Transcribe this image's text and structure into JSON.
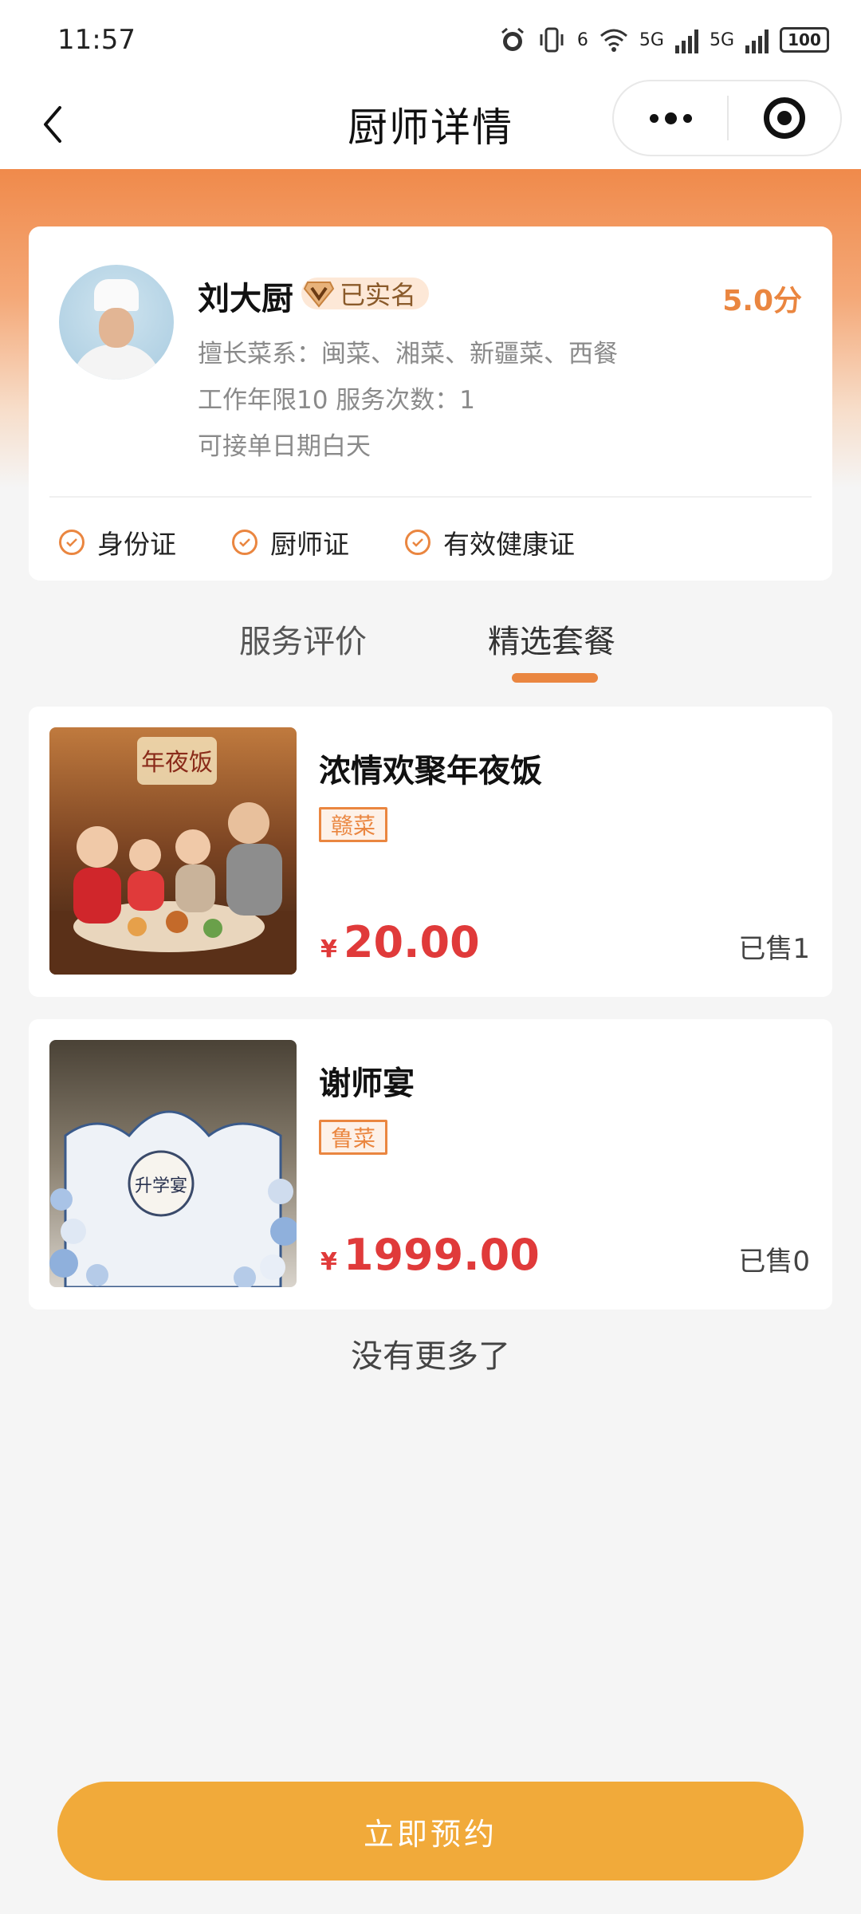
{
  "status_bar": {
    "time": "11:57",
    "network1": "6",
    "network2": "5G",
    "network3": "5G",
    "battery": "100",
    "icons": [
      "alarm-icon",
      "vibrate-icon",
      "wifi-icon",
      "signal-icon",
      "signal-icon",
      "battery-icon"
    ]
  },
  "nav": {
    "title": "厨师详情"
  },
  "chef": {
    "name": "刘大厨",
    "verified_label": "已实名",
    "score": "5.0分",
    "cuisines": "擅长菜系：闽菜、湘菜、新疆菜、西餐",
    "experience": "工作年限10 服务次数：1",
    "availability": "可接单日期白天",
    "certificates": [
      "身份证",
      "厨师证",
      "有效健康证"
    ]
  },
  "tabs": [
    {
      "label": "服务评价",
      "active": false
    },
    {
      "label": "精选套餐",
      "active": true
    }
  ],
  "packages": [
    {
      "title": "浓情欢聚年夜饭",
      "tag": "赣菜",
      "currency": "¥",
      "price": "20.00",
      "sold": "已售1",
      "image_text": "年夜饭"
    },
    {
      "title": "谢师宴",
      "tag": "鲁菜",
      "currency": "¥",
      "price": "1999.00",
      "sold": "已售0",
      "image_text": "升学宴"
    }
  ],
  "footer_text": "没有更多了",
  "book_button": "立即预约",
  "colors": {
    "accent": "#ea8640",
    "price": "#e03a3a",
    "button": "#f1aa3a",
    "header_gradient_top": "#f08a4b"
  }
}
